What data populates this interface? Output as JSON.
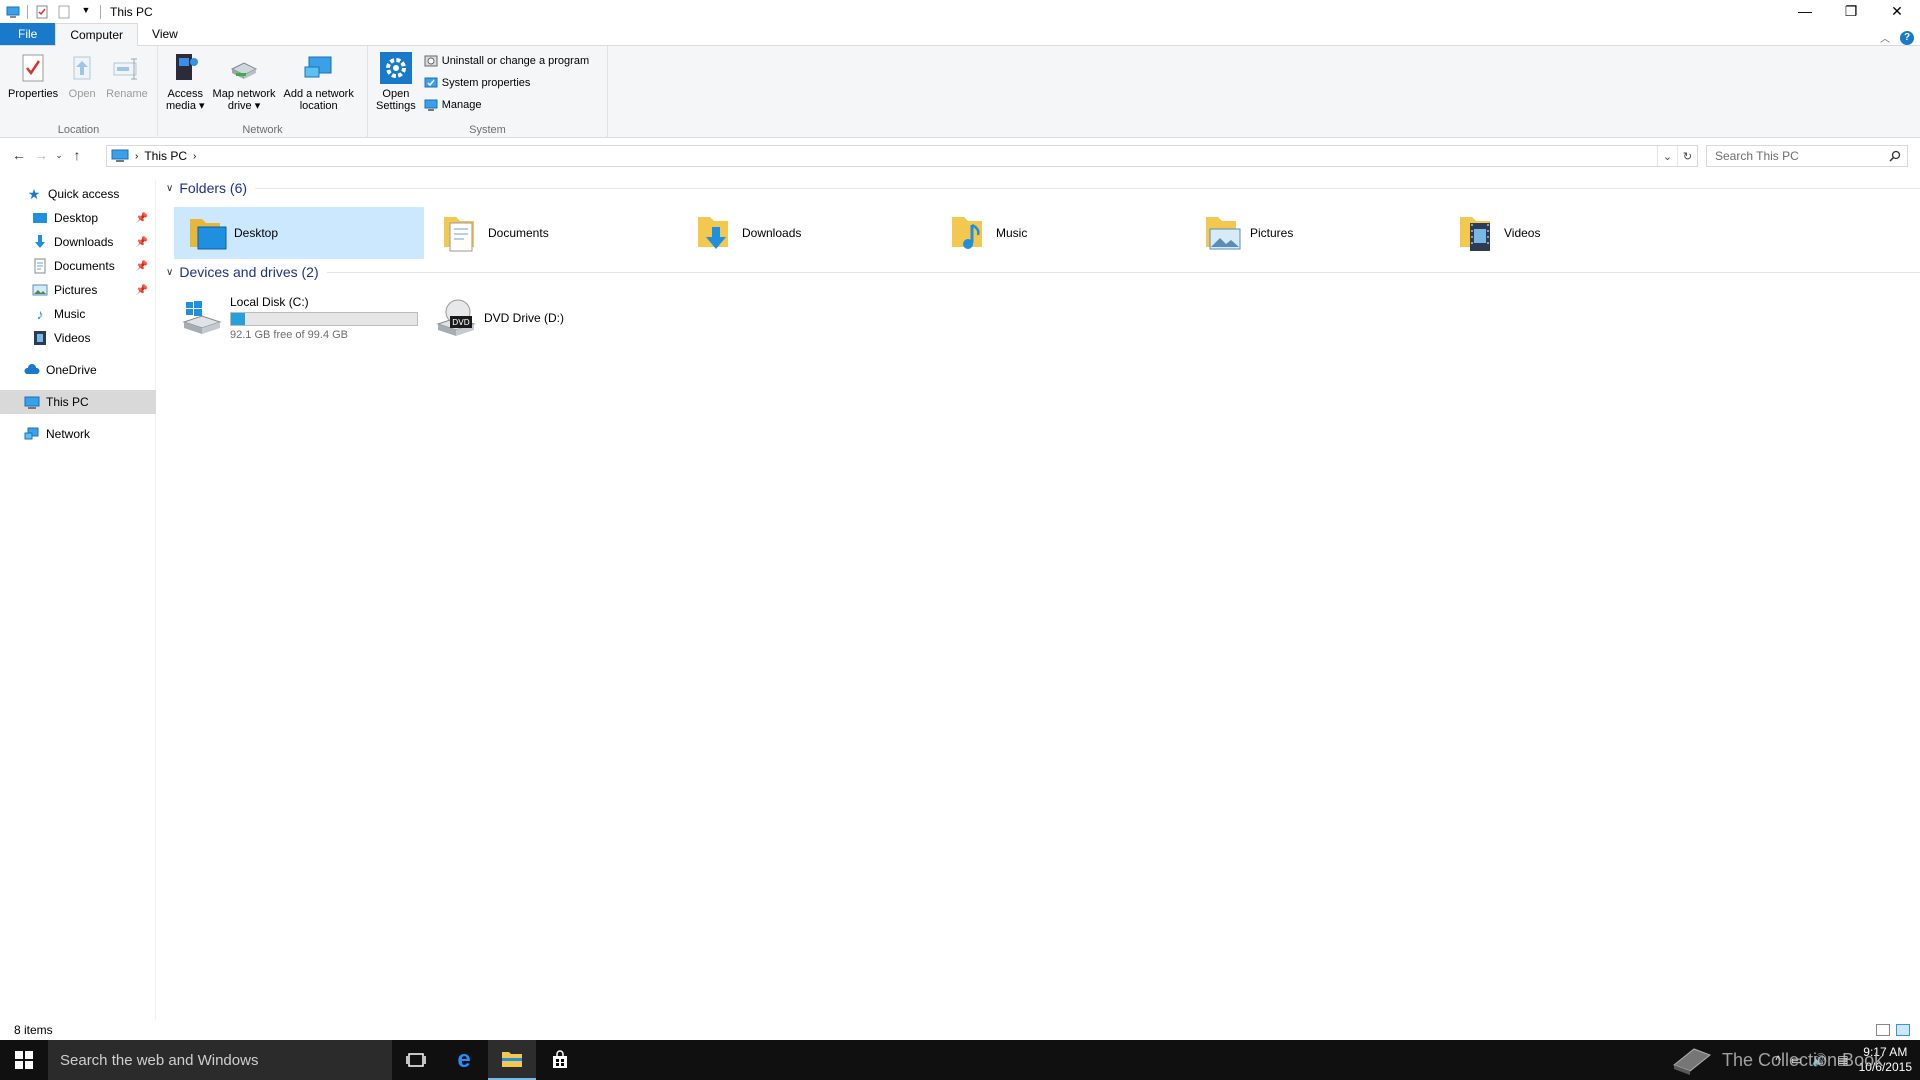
{
  "window": {
    "title": "This PC",
    "controls": {
      "minimize": "—",
      "restore": "❐",
      "close": "✕"
    }
  },
  "ribbon_tabs": [
    "File",
    "Computer",
    "View"
  ],
  "ribbon": {
    "location": {
      "label": "Location",
      "properties": "Properties",
      "open": "Open",
      "rename": "Rename"
    },
    "network": {
      "label": "Network",
      "access_media_1": "Access",
      "access_media_2": "media ▾",
      "map_drive_1": "Map network",
      "map_drive_2": "drive ▾",
      "add_location_1": "Add a network",
      "add_location_2": "location"
    },
    "system": {
      "label": "System",
      "open_settings_1": "Open",
      "open_settings_2": "Settings",
      "uninstall": "Uninstall or change a program",
      "system_properties": "System properties",
      "manage": "Manage"
    }
  },
  "address": {
    "crumb": "This PC",
    "search_placeholder": "Search This PC"
  },
  "nav": {
    "quick_access": "Quick access",
    "pinned": [
      "Desktop",
      "Downloads",
      "Documents",
      "Pictures"
    ],
    "unpinned": [
      "Music",
      "Videos"
    ],
    "onedrive": "OneDrive",
    "this_pc": "This PC",
    "network": "Network"
  },
  "sections": {
    "folders": "Folders (6)",
    "devices": "Devices and drives (2)"
  },
  "folders": [
    "Desktop",
    "Documents",
    "Downloads",
    "Music",
    "Pictures",
    "Videos"
  ],
  "drives": {
    "c_name": "Local Disk (C:)",
    "c_free": "92.1 GB free of 99.4 GB",
    "c_used_fraction": 0.073,
    "d_name": "DVD Drive (D:)"
  },
  "status": {
    "items": "8 items"
  },
  "taskbar": {
    "search": "Search the web and Windows",
    "time": "9:17 AM",
    "date": "10/6/2015",
    "watermark": "The Collection Book"
  },
  "colors": {
    "accent": "#1979ca",
    "selection": "#cce8ff",
    "folder": "#f3c84f",
    "drive_bar": "#26a0da"
  }
}
